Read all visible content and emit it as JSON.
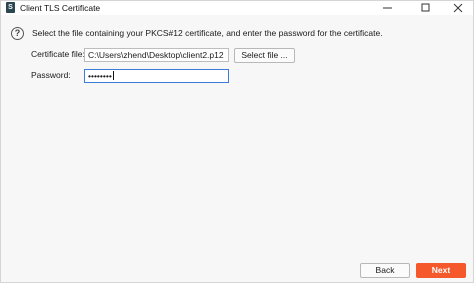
{
  "window": {
    "title": "Client TLS Certificate",
    "app_icon_glyph": "S",
    "icon": "app-logo-icon"
  },
  "controls": {
    "minimize_icon": "minimize-icon",
    "maximize_icon": "maximize-icon",
    "close_icon": "close-icon"
  },
  "content": {
    "help_glyph": "?",
    "instructions": "Select the file containing your PKCS#12 certificate, and enter the password for the certificate.",
    "certificate_file_label": "Certificate file:",
    "certificate_file_value": "C:\\Users\\zhend\\Desktop\\client2.p12",
    "select_file_label": "Select file ...",
    "password_label": "Password:",
    "password_value": "••••••••"
  },
  "footer": {
    "back_label": "Back",
    "next_label": "Next"
  },
  "colors": {
    "accent": "#f5582a",
    "focus_border": "#3d7bd9"
  }
}
